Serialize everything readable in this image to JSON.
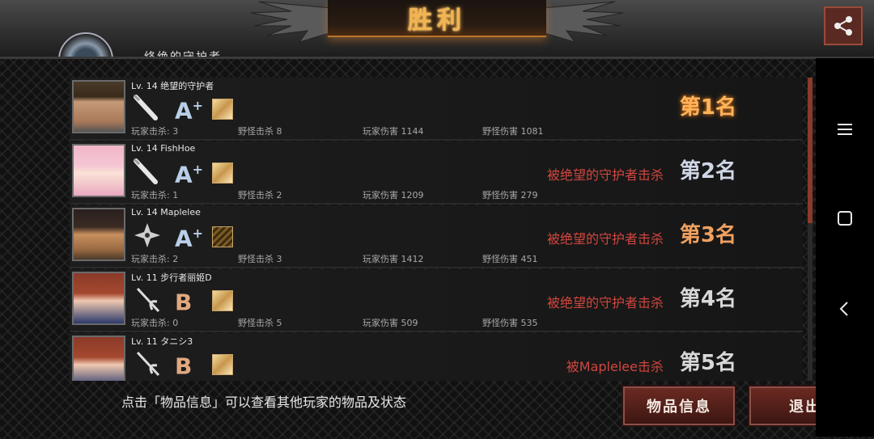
{
  "header": {
    "title": "胜利",
    "background_text": "终绝的守护者"
  },
  "players": [
    {
      "level_name": "Lv. 14 绝望的守护者",
      "weapon": "bat-icon",
      "grade": "A",
      "grade_plus": "+",
      "item": "gold",
      "player_kills": "玩家击杀: 3",
      "monster_kills": "野怪击杀 8",
      "player_damage": "玩家伤害 1144",
      "monster_damage": "野怪伤害 1081",
      "killed_by": "",
      "rank": "第1名"
    },
    {
      "level_name": "Lv. 14 FishHoe",
      "weapon": "bat-icon",
      "grade": "A",
      "grade_plus": "+",
      "item": "gold",
      "player_kills": "玩家击杀: 1",
      "monster_kills": "野怪击杀 2",
      "player_damage": "玩家伤害 1209",
      "monster_damage": "野怪伤害 279",
      "killed_by": "被绝望的守护者击杀",
      "rank": "第2名"
    },
    {
      "level_name": "Lv. 14 Maplelee",
      "weapon": "shuriken-icon",
      "grade": "A",
      "grade_plus": "+",
      "item": "dark",
      "player_kills": "玩家击杀: 2",
      "monster_kills": "野怪击杀 3",
      "player_damage": "玩家伤害 1412",
      "monster_damage": "野怪伤害 451",
      "killed_by": "被绝望的守护者击杀",
      "rank": "第3名"
    },
    {
      "level_name": "Lv. 11 步行者丽姬D",
      "weapon": "rapier-icon",
      "grade": "B",
      "grade_plus": "",
      "item": "gold",
      "player_kills": "玩家击杀: 0",
      "monster_kills": "野怪击杀 5",
      "player_damage": "玩家伤害 509",
      "monster_damage": "野怪伤害 535",
      "killed_by": "被绝望的守护者击杀",
      "rank": "第4名"
    },
    {
      "level_name": "Lv. 11 タニシ3",
      "weapon": "rapier-icon",
      "grade": "B",
      "grade_plus": "",
      "item": "gold",
      "player_kills": "",
      "monster_kills": "",
      "player_damage": "",
      "monster_damage": "",
      "killed_by": "被Maplelee击杀",
      "rank": "第5名"
    }
  ],
  "footer": {
    "hint": "点击「物品信息」可以查看其他玩家的物品及状态",
    "items_button": "物品信息",
    "exit_button": "退出"
  },
  "colors": {
    "title_gold": "#f0b552",
    "killed_red": "#d2463e",
    "button_red": "#6a2a22"
  }
}
